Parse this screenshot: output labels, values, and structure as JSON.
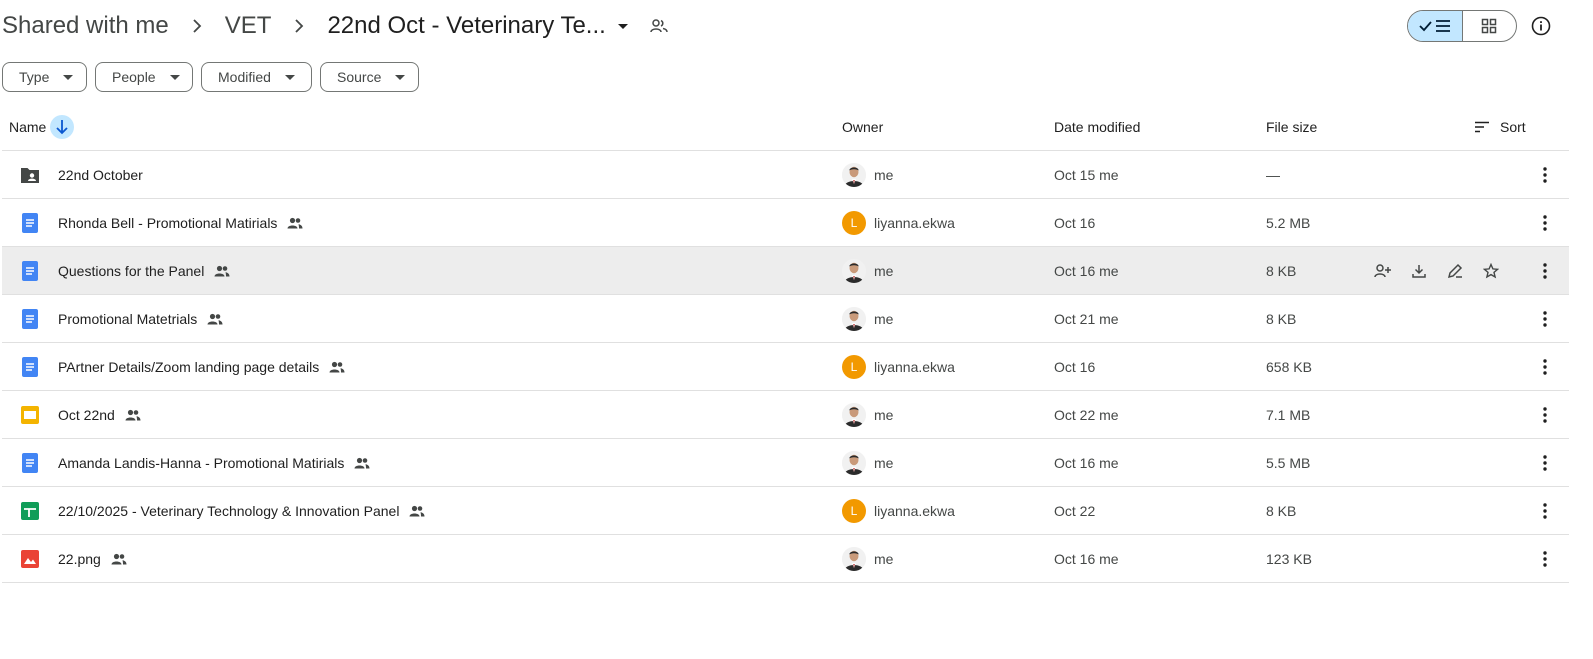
{
  "breadcrumb": {
    "root": "Shared with me",
    "separator": "›",
    "parent": "VET",
    "current": "22nd Oct - Veterinary Te..."
  },
  "filters": {
    "type": "Type",
    "people": "People",
    "modified": "Modified",
    "source": "Source"
  },
  "columns": {
    "name": "Name",
    "owner": "Owner",
    "date_modified": "Date modified",
    "file_size": "File size",
    "sort": "Sort"
  },
  "files": [
    {
      "name": "22nd October",
      "kind": "folder-shared",
      "shared": false,
      "owner": "me",
      "avatar": "photo",
      "avatar_letter": "",
      "modified": "Oct 15 me",
      "size": "—"
    },
    {
      "name": "Rhonda Bell - Promotional Matirials",
      "kind": "doc",
      "shared": true,
      "owner": "liyanna.ekwa",
      "avatar": "letter",
      "avatar_letter": "L",
      "modified": "Oct 16",
      "size": "5.2 MB"
    },
    {
      "name": "Questions for the Panel",
      "kind": "doc",
      "shared": true,
      "owner": "me",
      "avatar": "photo",
      "avatar_letter": "",
      "modified": "Oct 16 me",
      "size": "8 KB"
    },
    {
      "name": "Promotional Matetrials",
      "kind": "doc",
      "shared": true,
      "owner": "me",
      "avatar": "photo",
      "avatar_letter": "",
      "modified": "Oct 21 me",
      "size": "8 KB"
    },
    {
      "name": "PArtner Details/Zoom landing page details",
      "kind": "doc",
      "shared": true,
      "owner": "liyanna.ekwa",
      "avatar": "letter",
      "avatar_letter": "L",
      "modified": "Oct 16",
      "size": "658 KB"
    },
    {
      "name": "Oct 22nd",
      "kind": "slides",
      "shared": true,
      "owner": "me",
      "avatar": "photo",
      "avatar_letter": "",
      "modified": "Oct 22 me",
      "size": "7.1 MB"
    },
    {
      "name": "Amanda Landis-Hanna - Promotional Matirials",
      "kind": "doc",
      "shared": true,
      "owner": "me",
      "avatar": "photo",
      "avatar_letter": "",
      "modified": "Oct 16 me",
      "size": "5.5 MB"
    },
    {
      "name": "22/10/2025 - Veterinary Technology & Innovation Panel",
      "kind": "sheet",
      "shared": true,
      "owner": "liyanna.ekwa",
      "avatar": "letter",
      "avatar_letter": "L",
      "modified": "Oct 22",
      "size": "8 KB"
    },
    {
      "name": "22.png",
      "kind": "image",
      "shared": true,
      "owner": "me",
      "avatar": "photo",
      "avatar_letter": "",
      "modified": "Oct 16 me",
      "size": "123 KB"
    }
  ],
  "hovered_row": 2,
  "colors": {
    "doc": "#4285f4",
    "slides": "#f4b400",
    "sheet": "#0f9d58",
    "image": "#ea4335",
    "folder": "#444746",
    "active_toggle": "#c2e7ff",
    "avatar_letter_bg": "#f29900"
  }
}
